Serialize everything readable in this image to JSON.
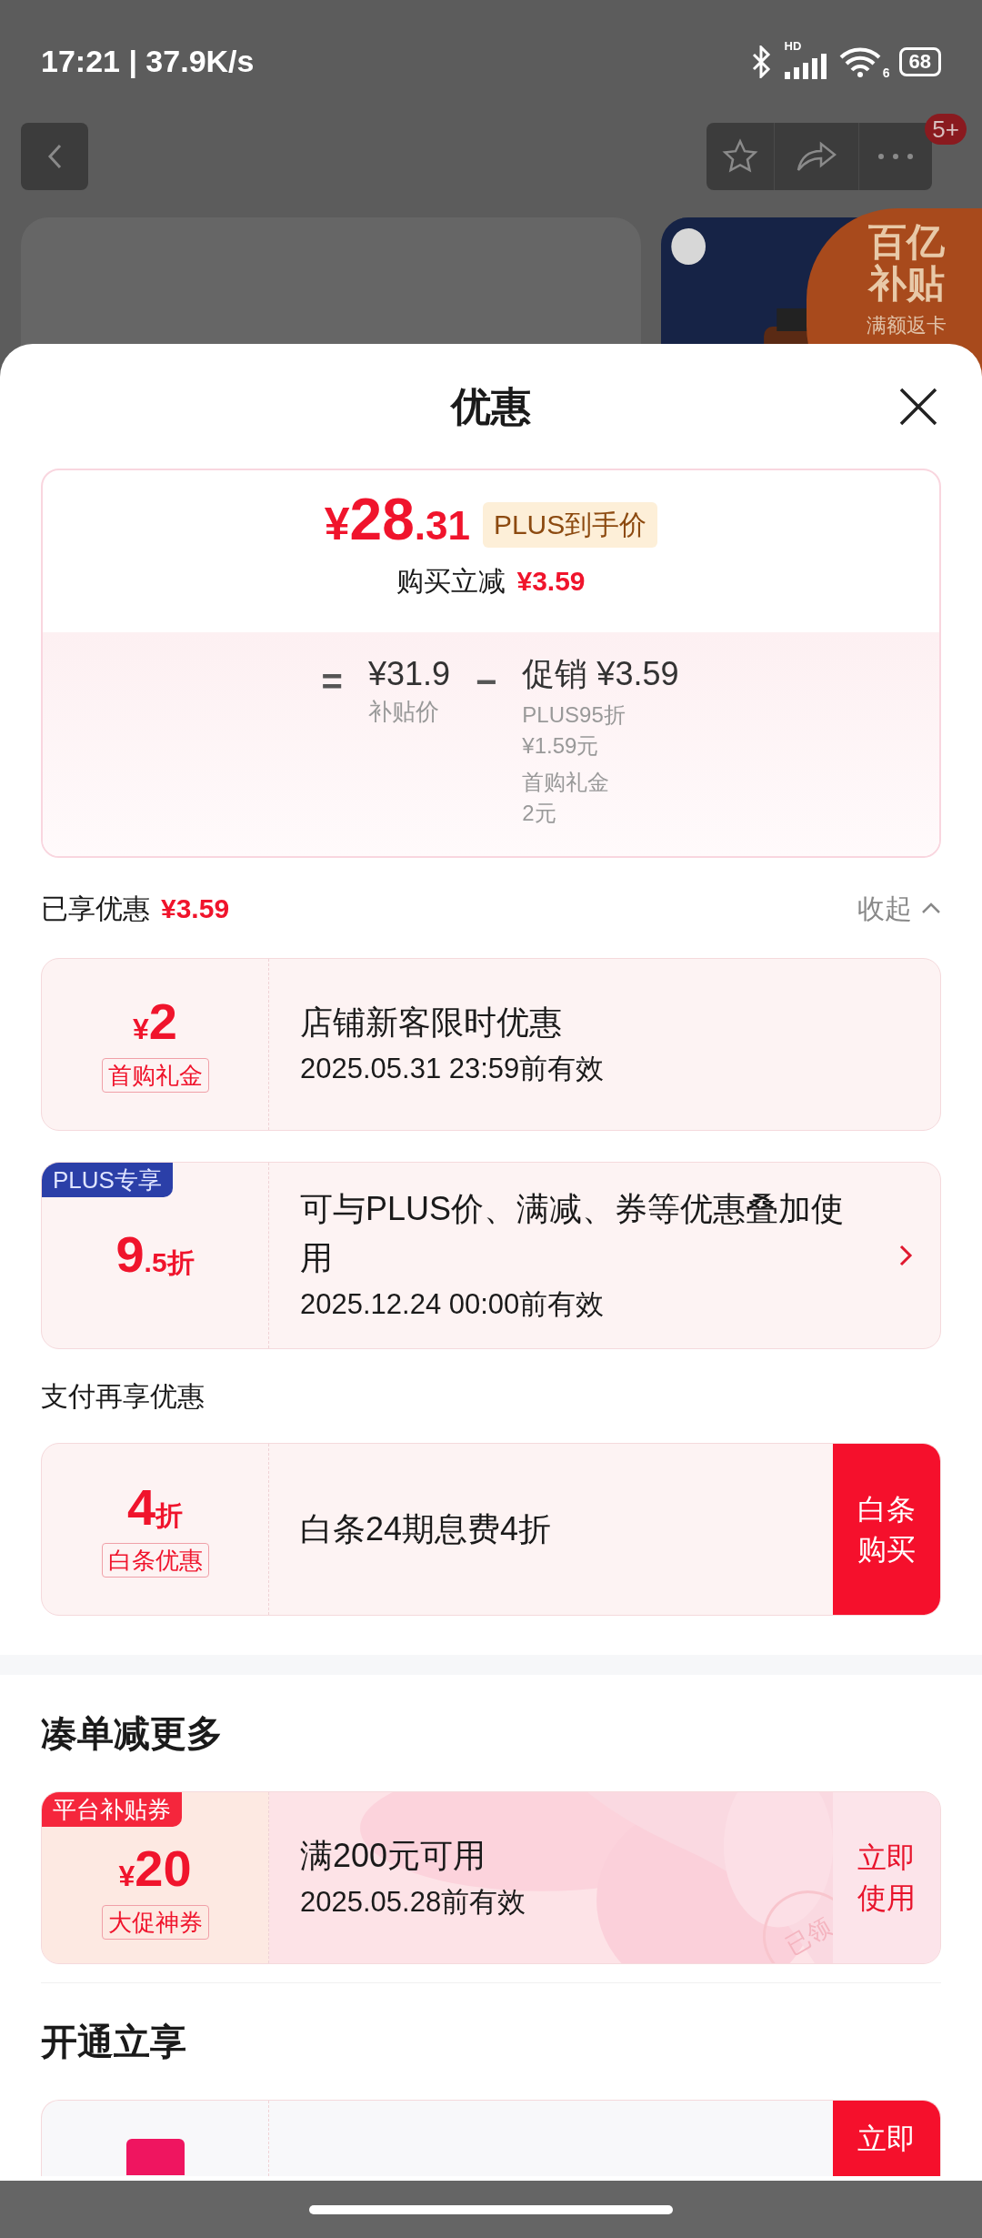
{
  "status_bar": {
    "time_speed": "17:21 | 37.9K/s",
    "signal_label": "HD",
    "wifi_label": "6",
    "battery": "68"
  },
  "nav": {
    "badge": "5+"
  },
  "background": {
    "badge_title": "百亿补贴",
    "badge_sub": "满额返卡"
  },
  "sheet": {
    "title": "优惠"
  },
  "price_card": {
    "currency": "¥",
    "price_main": "28",
    "price_decimal": ".31",
    "tag": "PLUS到手价",
    "reduce_label": "购买立减",
    "reduce_amount": "¥3.59",
    "equals": "=",
    "base_price": "¥31.9",
    "base_label": "补贴价",
    "minus": "−",
    "promo": "促销 ¥3.59",
    "details": [
      {
        "label": "PLUS95折",
        "amount": "¥1.59元"
      },
      {
        "label": "首购礼金",
        "amount": "2元"
      }
    ]
  },
  "savings": {
    "label": "已享优惠",
    "amount": "¥3.59",
    "toggle": "收起"
  },
  "sections": [
    {
      "coupons": [
        {
          "kind": "plain",
          "prefix": "¥",
          "value": "2",
          "tag": "首购礼金",
          "title": "店铺新客限时优惠",
          "validity": "2025.05.31 23:59前有效"
        },
        {
          "kind": "plain",
          "corner": {
            "kind": "plus",
            "text": "PLUS专享"
          },
          "value": "9",
          "suffix": ".5折",
          "title": "可与PLUS价、满减、券等优惠叠加使用",
          "validity": "2025.12.24 00:00前有效",
          "chevron": true
        }
      ]
    },
    {
      "heading": "支付再享优惠",
      "coupons": [
        {
          "kind": "plain",
          "value": "4",
          "suffix": "折",
          "tag": "白条优惠",
          "title": "白条24期息费4折",
          "action": {
            "kind": "solid",
            "lines": [
              "白条",
              "购买"
            ]
          }
        }
      ]
    },
    {
      "heading": "凑单减更多",
      "divider": true,
      "coupons": [
        {
          "kind": "festive",
          "corner": {
            "kind": "platform",
            "text": "平台补贴券"
          },
          "prefix": "¥",
          "value": "20",
          "tag": "大促神券",
          "title": "满200元可用",
          "validity": "2025.05.28前有效",
          "stamp": "已领",
          "action": {
            "kind": "soft",
            "lines": [
              "立即",
              "使用"
            ]
          }
        }
      ]
    },
    {
      "heading": "开通立享",
      "coupons": [
        {
          "kind": "cut",
          "action": {
            "kind": "solid",
            "lines": [
              "立即"
            ]
          }
        }
      ]
    }
  ]
}
